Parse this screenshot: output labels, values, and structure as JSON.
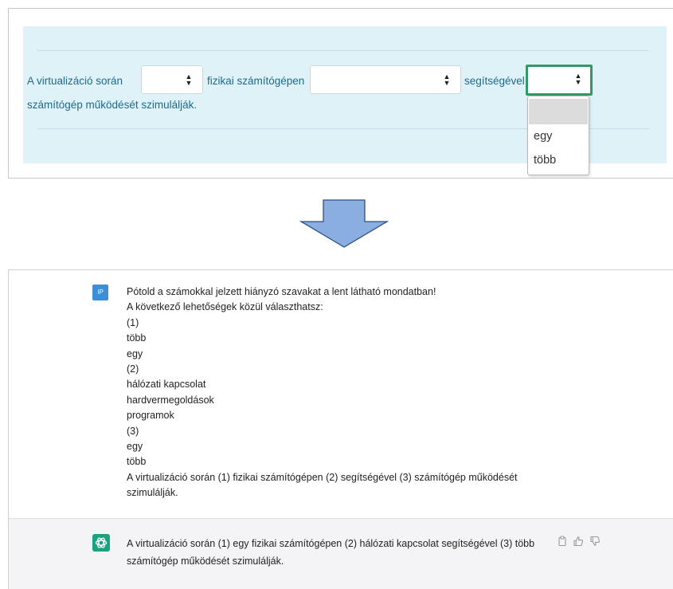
{
  "quiz": {
    "sentence_part1": "A virtualizáció során",
    "sentence_part2": "fizikai számítógépen",
    "sentence_part3": "segítségével",
    "sentence_part4": "számítógép működését szimulálják.",
    "dropdown_options": [
      "",
      "egy",
      "több"
    ],
    "select_caret": "◆",
    "accent_color": "#2f9a66",
    "panel_color": "#def2f8"
  },
  "arrow": {
    "icon": "down-arrow-icon",
    "fill": "#8aaee0"
  },
  "chat": {
    "user_avatar": "IP",
    "user_message_lines": [
      "Pótold a számokkal jelzett hiányzó szavakat a lent látható mondatban!",
      "A következő lehetőségek közül választhatsz:",
      "(1)",
      "több",
      "egy",
      "(2)",
      "hálózati kapcsolat",
      "hardvermegoldások",
      "programok",
      "(3)",
      "egy",
      "több",
      "A virtualizáció során (1) fizikai számítógépen (2) segítségével (3) számítógép működését",
      "szimulálják."
    ],
    "bot_message_lines": [
      "A virtualizáció során (1) egy fizikai számítógépen (2) hálózati kapcsolat segítségével (3) több",
      "számítógép működését szimulálják."
    ],
    "bot_avatar_color": "#19a37f",
    "action_icons": [
      "copy-icon",
      "thumbs-up-icon",
      "thumbs-down-icon"
    ]
  }
}
